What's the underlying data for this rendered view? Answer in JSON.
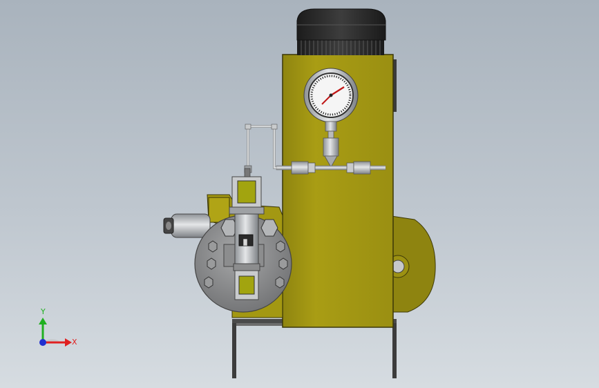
{
  "viewport": {
    "background_top": "#a9b3bd",
    "background_bottom": "#d6dce1"
  },
  "triad": {
    "x_label": "X",
    "y_label": "Y",
    "x_color": "#e02020",
    "y_color": "#20b020",
    "z_color": "#2030d0"
  },
  "model": {
    "body_color": "#a89c12",
    "body_shade": "#8c8210",
    "motor_color": "#2b2b2b",
    "steel_color": "#b9bcbf",
    "frame_color": "#3a3a3a"
  }
}
